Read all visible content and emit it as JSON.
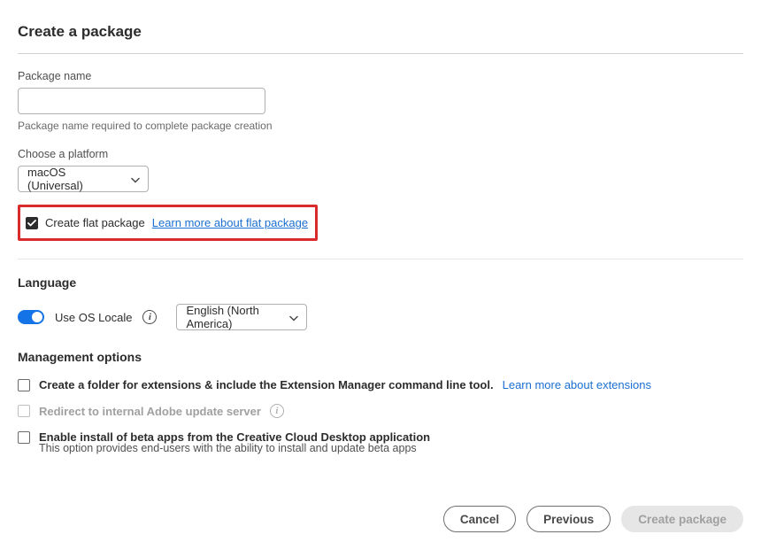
{
  "title": "Create a package",
  "packageName": {
    "label": "Package name",
    "value": "",
    "helper": "Package name required to complete package creation"
  },
  "platform": {
    "label": "Choose a platform",
    "selected": "macOS (Universal)"
  },
  "flat": {
    "label": "Create flat package",
    "link": "Learn more about flat package"
  },
  "language": {
    "heading": "Language",
    "useOsLocale": "Use OS Locale",
    "selected": "English (North America)"
  },
  "mgmt": {
    "heading": "Management options",
    "ext": {
      "label": "Create a folder for extensions & include the Extension Manager command line tool.",
      "link": "Learn more about extensions"
    },
    "redirect": {
      "label": "Redirect to internal Adobe update server"
    },
    "beta": {
      "label": "Enable install of beta apps from the Creative Cloud Desktop application",
      "helper": "This option provides end-users with the ability to install and update beta apps"
    }
  },
  "footer": {
    "cancel": "Cancel",
    "previous": "Previous",
    "create": "Create package"
  }
}
